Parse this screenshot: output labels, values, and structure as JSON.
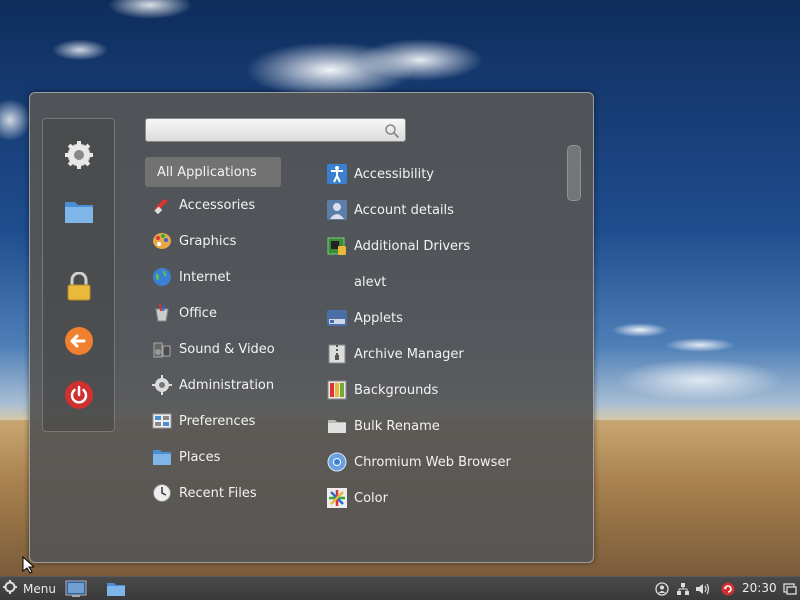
{
  "search": {
    "value": "",
    "placeholder": ""
  },
  "favorites": [
    {
      "icon": "settings-gear-icon"
    },
    {
      "icon": "folder-icon"
    },
    {
      "icon": "lock-icon"
    },
    {
      "icon": "logout-arrow-icon"
    },
    {
      "icon": "power-icon"
    }
  ],
  "categories": [
    {
      "label": "All Applications",
      "icon": "",
      "selected": true
    },
    {
      "label": "Accessories",
      "icon": "accessories-icon"
    },
    {
      "label": "Graphics",
      "icon": "graphics-palette-icon"
    },
    {
      "label": "Internet",
      "icon": "globe-icon"
    },
    {
      "label": "Office",
      "icon": "office-icon"
    },
    {
      "label": "Sound & Video",
      "icon": "multimedia-icon"
    },
    {
      "label": "Administration",
      "icon": "gear-icon"
    },
    {
      "label": "Preferences",
      "icon": "preferences-icon"
    },
    {
      "label": "Places",
      "icon": "folder-icon"
    },
    {
      "label": "Recent Files",
      "icon": "clock-icon"
    }
  ],
  "applications": [
    {
      "label": "Accessibility",
      "icon": "accessibility-icon"
    },
    {
      "label": "Account details",
      "icon": "user-account-icon"
    },
    {
      "label": "Additional Drivers",
      "icon": "drivers-chip-icon"
    },
    {
      "label": "alevt",
      "icon": ""
    },
    {
      "label": "Applets",
      "icon": "applets-icon"
    },
    {
      "label": "Archive Manager",
      "icon": "archive-icon"
    },
    {
      "label": "Backgrounds",
      "icon": "backgrounds-icon"
    },
    {
      "label": "Bulk Rename",
      "icon": "folder-rename-icon"
    },
    {
      "label": "Chromium Web Browser",
      "icon": "chromium-icon"
    },
    {
      "label": "Color",
      "icon": "color-icon"
    }
  ],
  "taskbar": {
    "menu_label": "Menu",
    "clock": "20:30",
    "tray_icons": [
      "user-status-icon",
      "network-icon",
      "volume-icon",
      "update-icon",
      "window-list-icon"
    ]
  },
  "colors": {
    "accent_orange": "#f08030",
    "power_red": "#d03030",
    "panel_bg": "#555555"
  }
}
